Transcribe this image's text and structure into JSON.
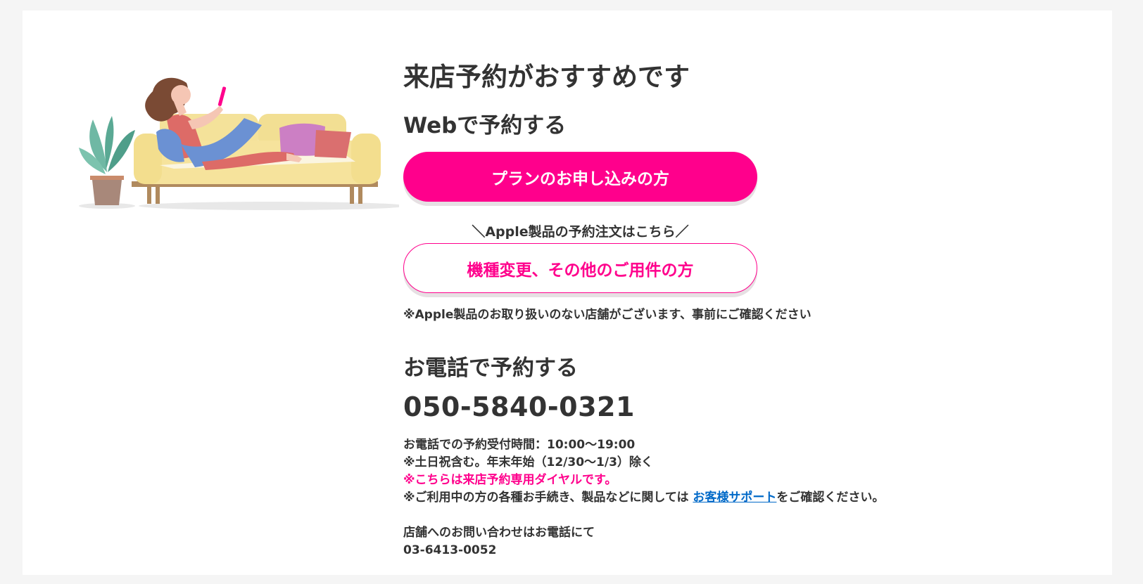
{
  "reservation": {
    "title": "来店予約がおすすめです",
    "web_heading": "Webで予約する",
    "plan_button": "プランのお申し込みの方",
    "apple_caption": "＼Apple製品の予約注文はこちら／",
    "device_button": "機種変更、その他のご用件の方",
    "apple_note": "※Apple製品のお取り扱いのない店舗がございます、事前にご確認ください",
    "phone_heading": "お電話で予約する",
    "phone_number": "050-5840-0321",
    "hours": "お電話での予約受付時間：10:00〜19:00",
    "holidays": "※土日祝含む。年末年始（12/30〜1/3）除く",
    "dedicated_notice": "※こちらは来店予約専用ダイヤルです。",
    "support_prefix": "※ご利用中の方の各種お手続き、製品などに関しては ",
    "support_link": "お客様サポート",
    "support_suffix": "をご確認ください。",
    "store_inquiry": "店舗へのお問い合わせはお電話にて",
    "store_phone": "03-6413-0052"
  },
  "colors": {
    "accent": "#ff008c",
    "link": "#0069c8",
    "text": "#333333",
    "background": "#f5f5f5"
  }
}
